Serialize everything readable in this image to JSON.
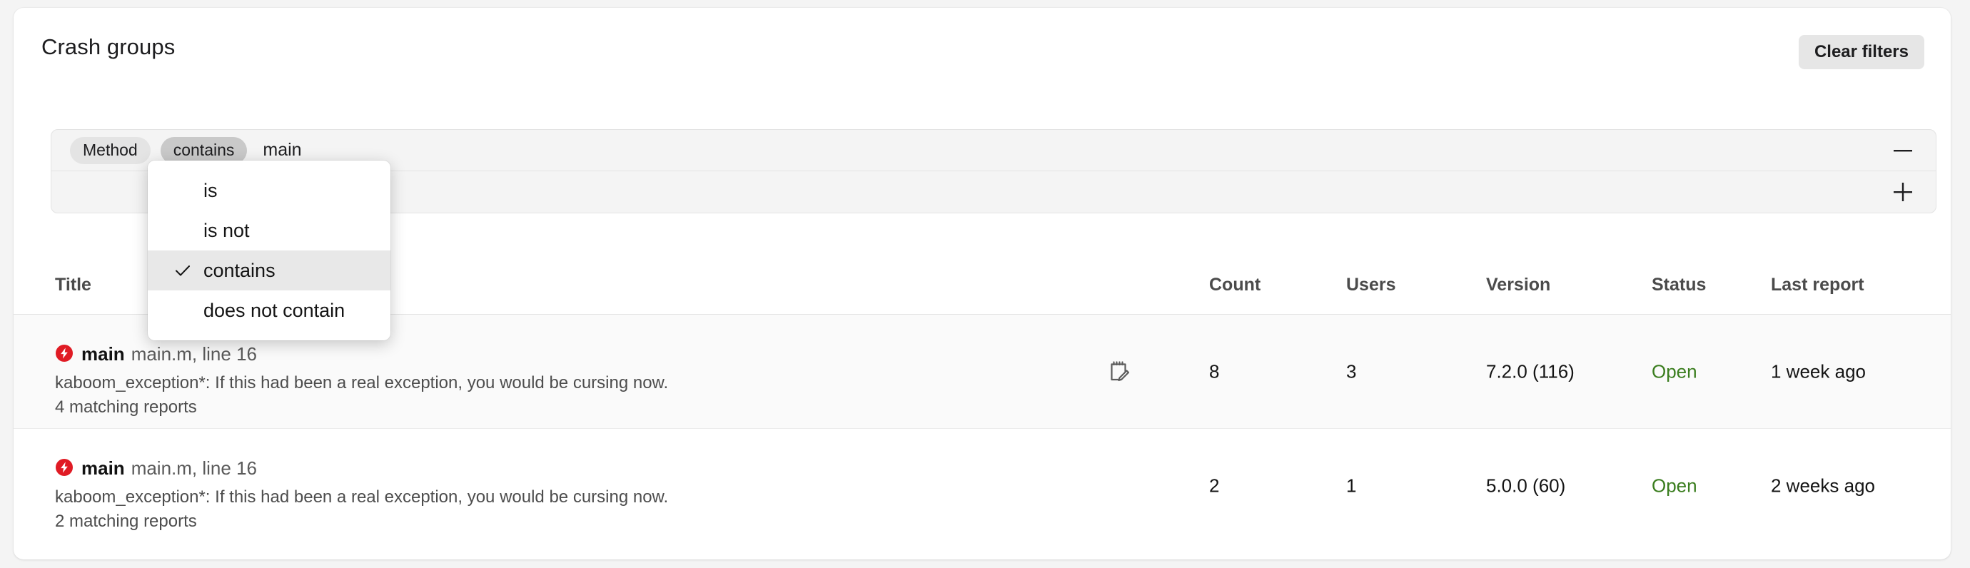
{
  "header": {
    "title": "Crash groups",
    "clear_filters_label": "Clear filters"
  },
  "filters": {
    "rows": [
      {
        "field_label": "Method",
        "operator_label": "contains",
        "value": "main",
        "action_icon": "minus-icon"
      },
      {
        "action_icon": "plus-icon"
      }
    ],
    "operator_menu": {
      "open": true,
      "selected": "contains",
      "items": [
        {
          "label": "is",
          "checked": false
        },
        {
          "label": "is not",
          "checked": false
        },
        {
          "label": "contains",
          "checked": true
        },
        {
          "label": "does not contain",
          "checked": false
        }
      ]
    }
  },
  "table": {
    "columns": {
      "title": "Title",
      "count": "Count",
      "users": "Users",
      "version": "Version",
      "status": "Status",
      "last_report": "Last report"
    },
    "rows": [
      {
        "icon": "crash-bolt-icon",
        "method": "main",
        "location": "main.m, line 16",
        "exception": "kaboom_exception*: If this had been a real exception, you would be cursing now.",
        "matching_reports": "4 matching reports",
        "has_note": true,
        "note_icon": "note-edit-icon",
        "count": "8",
        "users": "3",
        "version": "7.2.0 (116)",
        "status": "Open",
        "last_report": "1 week ago"
      },
      {
        "icon": "crash-bolt-icon",
        "method": "main",
        "location": "main.m, line 16",
        "exception": "kaboom_exception*: If this had been a real exception, you would be cursing now.",
        "matching_reports": "2 matching reports",
        "has_note": false,
        "note_icon": "",
        "count": "2",
        "users": "1",
        "version": "5.0.0 (60)",
        "status": "Open",
        "last_report": "2 weeks ago"
      }
    ]
  },
  "colors": {
    "page_background": "#f4f4f4",
    "card_background": "#ffffff",
    "status_open": "#3a7d1e",
    "crash_icon": "#e01b24",
    "pill_field": "#e4e4e4",
    "pill_operator": "#c9c9c9",
    "menu_selected": "#e8e8e8"
  }
}
